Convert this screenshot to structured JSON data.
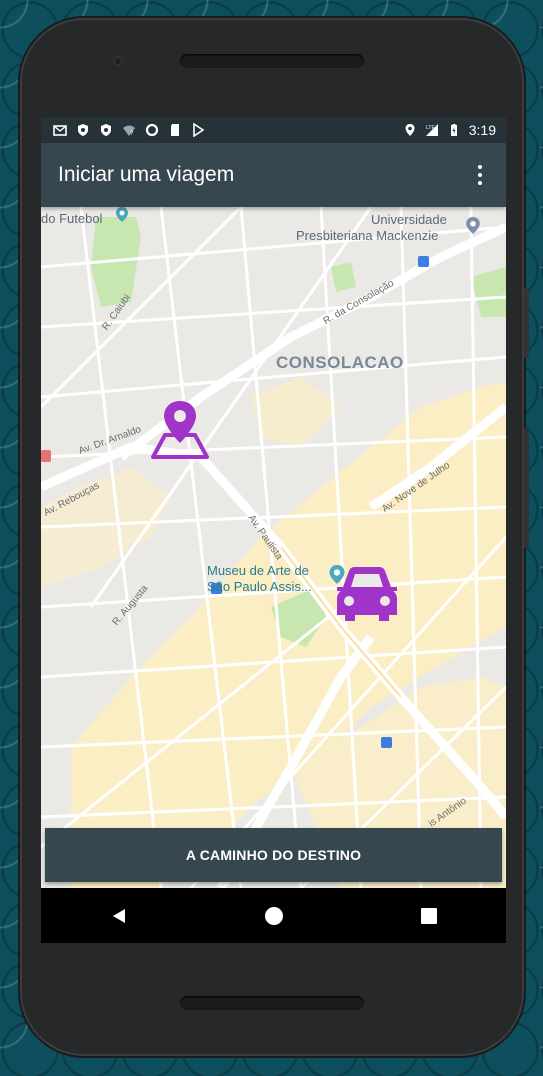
{
  "status_bar": {
    "time": "3:19",
    "network": "LTE",
    "left_icons": [
      "mail-icon",
      "shield-icon",
      "shield-icon",
      "wifi-icon",
      "circle-icon",
      "sd-card-icon",
      "play-store-icon"
    ],
    "right_icons": [
      "location-icon",
      "signal-icon",
      "battery-icon"
    ]
  },
  "app_bar": {
    "title": "Iniciar uma viagem",
    "menu_icon": "overflow-menu-icon"
  },
  "map": {
    "district": "CONSOLACAO",
    "places": {
      "futebol": "do Futebol",
      "university_line1": "Universidade",
      "university_line2": "Presbiteriana Mackenzie",
      "museum_line1": "Museu de Arte de",
      "museum_line2": "São Paulo Assis..."
    },
    "streets": {
      "caiubi": "R. Caiubi",
      "consolacao": "R. da Consolação",
      "arnaldo": "Av. Dr. Arnaldo",
      "reboucas": "Av. Rebouças",
      "nove_julho": "Av. Nove de Julho",
      "paulista": "Av. Paulista",
      "augusta": "R. Augusta",
      "santo_antonio": "is Antônio"
    },
    "markers": {
      "destination": "location-pin-icon",
      "vehicle": "car-icon"
    },
    "marker_color": "#a033c8"
  },
  "action": {
    "label": "A CAMINHO DO DESTINO"
  },
  "nav_bar": {
    "back": "back-icon",
    "home": "home-icon",
    "recents": "recents-icon"
  },
  "colors": {
    "app_bar": "#37474f",
    "status_bar": "#263238",
    "background": "#0d4f5c"
  }
}
